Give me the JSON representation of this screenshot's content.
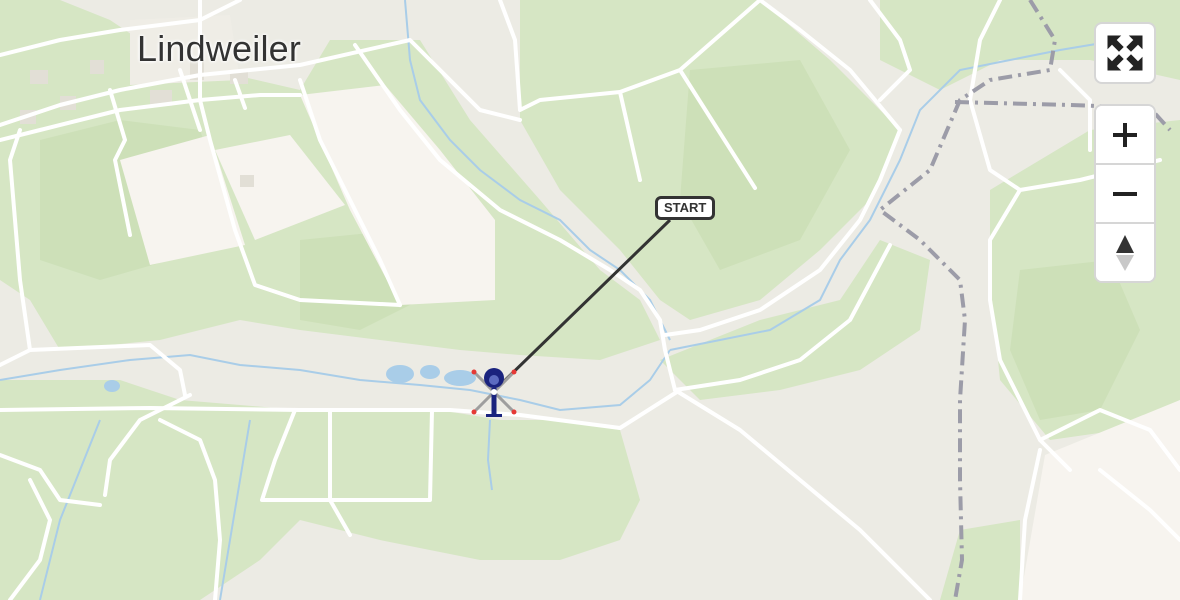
{
  "map": {
    "place_label": "Lindweiler",
    "start_label": "START",
    "route": {
      "from": "start",
      "to": "helicopter"
    },
    "icons": {
      "helicopter": "helicopter-icon",
      "fullscreen": "fullscreen-icon",
      "zoom_in": "plus-icon",
      "zoom_out": "minus-icon",
      "compass": "compass-north-icon"
    },
    "colors": {
      "land": "#ecebe4",
      "forest": "#d6e6c4",
      "forest_dark": "#cfe2bc",
      "field": "#f7f4ef",
      "road": "#ffffff",
      "water": "#a9cde8",
      "boundary": "#9c9ca8",
      "route_line": "#333333",
      "helicopter_body": "#1a237e"
    }
  },
  "controls": {
    "fullscreen_label": "",
    "zoom_in_label": "",
    "zoom_out_label": "",
    "compass_label": ""
  }
}
